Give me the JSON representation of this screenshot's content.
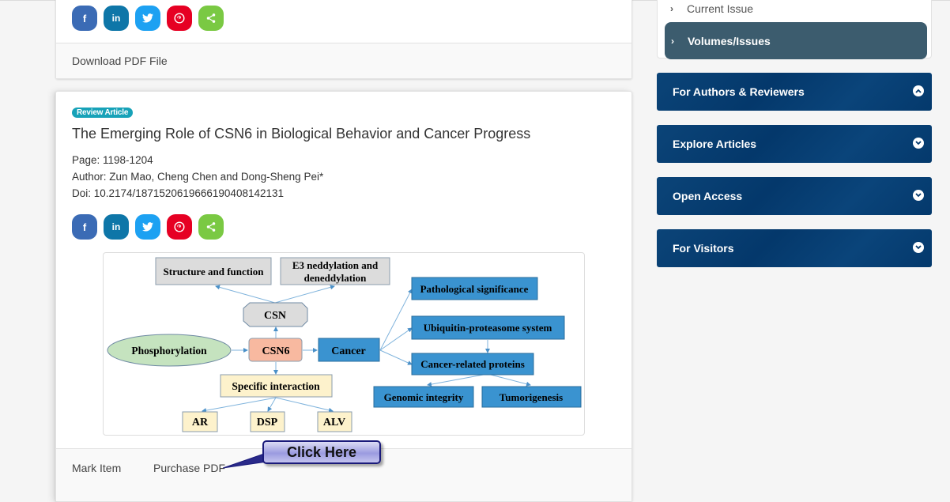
{
  "previous_article": {
    "share_buttons": [
      {
        "icon": "facebook-icon",
        "glyph": "f",
        "color": "#3b6bb5"
      },
      {
        "icon": "linkedin-icon",
        "glyph": "in",
        "color": "#0e76a8"
      },
      {
        "icon": "twitter-icon",
        "glyph": "twitter",
        "color": "#1da1f2"
      },
      {
        "icon": "pinterest-icon",
        "glyph": "pinterest",
        "color": "#e60023"
      },
      {
        "icon": "share-icon",
        "glyph": "share",
        "color": "#7ac943"
      }
    ],
    "download_label": "Download PDF File"
  },
  "article": {
    "badge": "Review Article",
    "title": "The Emerging Role of CSN6 in Biological Behavior and Cancer Progress",
    "page": "Page: 1198-1204",
    "author": "Author: Zun Mao, Cheng Chen and Dong-Sheng Pei*",
    "doi": "Doi: 10.2174/1871520619666190408142131",
    "share_buttons": [
      {
        "icon": "facebook-icon",
        "glyph": "f",
        "color": "#3b6bb5"
      },
      {
        "icon": "linkedin-icon",
        "glyph": "in",
        "color": "#0e76a8"
      },
      {
        "icon": "twitter-icon",
        "glyph": "twitter",
        "color": "#1da1f2"
      },
      {
        "icon": "pinterest-icon",
        "glyph": "pinterest",
        "color": "#e60023"
      },
      {
        "icon": "share-icon",
        "glyph": "share",
        "color": "#7ac943"
      }
    ],
    "figure": {
      "nodes": {
        "structure": "Structure and function",
        "e3_line1": "E3 neddylation and",
        "e3_line2": "deneddylation",
        "csn": "CSN",
        "phosphorylation": "Phosphorylation",
        "csn6": "CSN6",
        "cancer": "Cancer",
        "specific": "Specific interaction",
        "ar": "AR",
        "dsp": "DSP",
        "alv": "ALV",
        "pathological": "Pathological significance",
        "ubiquitin": "Ubiquitin-proteasome system",
        "cancer_related": "Cancer-related proteins",
        "genomic": "Genomic integrity",
        "tumorigenesis": "Tumorigenesis"
      }
    },
    "mark_item": "Mark Item",
    "purchase_pdf": "Purchase PDF",
    "callout": "Click Here"
  },
  "sidebar": {
    "nav": [
      {
        "label": "Current Issue"
      },
      {
        "label": "Volumes/Issues",
        "active": true
      }
    ],
    "accordions": [
      {
        "label": "For Authors & Reviewers",
        "state": "expanded"
      },
      {
        "label": "Explore Articles",
        "state": "collapsed"
      },
      {
        "label": "Open Access",
        "state": "collapsed"
      },
      {
        "label": "For Visitors",
        "state": "collapsed"
      }
    ],
    "accent_color": "#04396c",
    "active_nav_color": "#3c5c6e"
  }
}
